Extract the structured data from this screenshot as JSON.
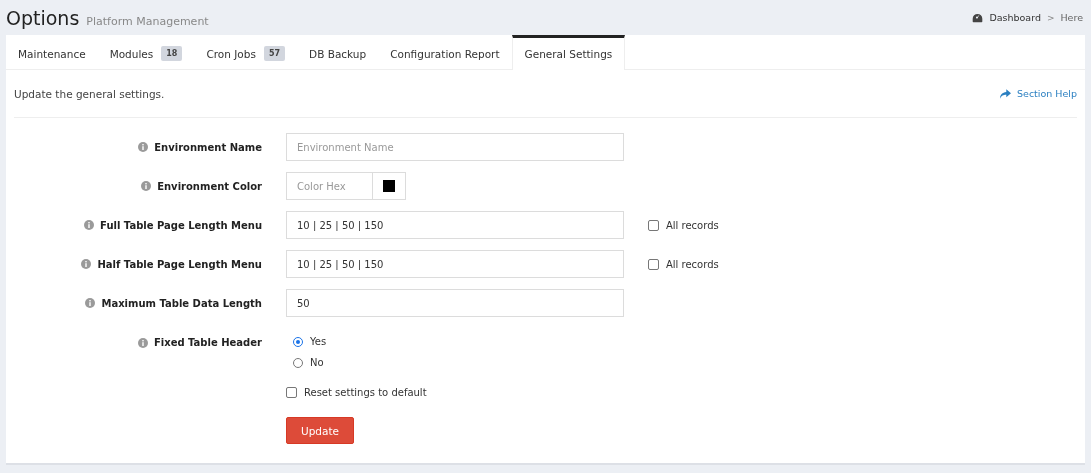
{
  "header": {
    "title": "Options",
    "subtitle": "Platform Management",
    "breadcrumb_separator": ">",
    "breadcrumb": [
      {
        "label": "Dashboard",
        "kind": "link"
      },
      {
        "label": "Here",
        "kind": "current"
      }
    ]
  },
  "tabs": [
    {
      "label": "Maintenance",
      "selected": false
    },
    {
      "label": "Modules",
      "badge": "18",
      "selected": false
    },
    {
      "label": "Cron Jobs",
      "badge": "57",
      "selected": false
    },
    {
      "label": "DB Backup",
      "selected": false
    },
    {
      "label": "Configuration Report",
      "selected": false
    },
    {
      "label": "General Settings",
      "selected": true
    }
  ],
  "intro": "Update the general settings.",
  "section_help": "Section Help",
  "fields": [
    {
      "kind": "text",
      "label": "Environment Name",
      "placeholder": "Environment Name"
    },
    {
      "kind": "color",
      "label": "Environment Color",
      "placeholder": "Color Hex",
      "color": "#000000"
    },
    {
      "kind": "text",
      "label": "Full Table Page Length Menu",
      "value": "10 | 25 | 50 | 150",
      "option": {
        "label": "All records",
        "checked": false
      }
    },
    {
      "kind": "text",
      "label": "Half Table Page Length Menu",
      "value": "10 | 25 | 50 | 150",
      "option": {
        "label": "All records",
        "checked": false
      }
    },
    {
      "kind": "text",
      "label": "Maximum Table Data Length",
      "value": "50"
    },
    {
      "kind": "radio",
      "label": "Fixed Table Header",
      "options": [
        {
          "label": "Yes",
          "selected": true
        },
        {
          "label": "No",
          "selected": false
        }
      ]
    }
  ],
  "reset": {
    "label": "Reset settings to default",
    "checked": false
  },
  "submit": "Update"
}
